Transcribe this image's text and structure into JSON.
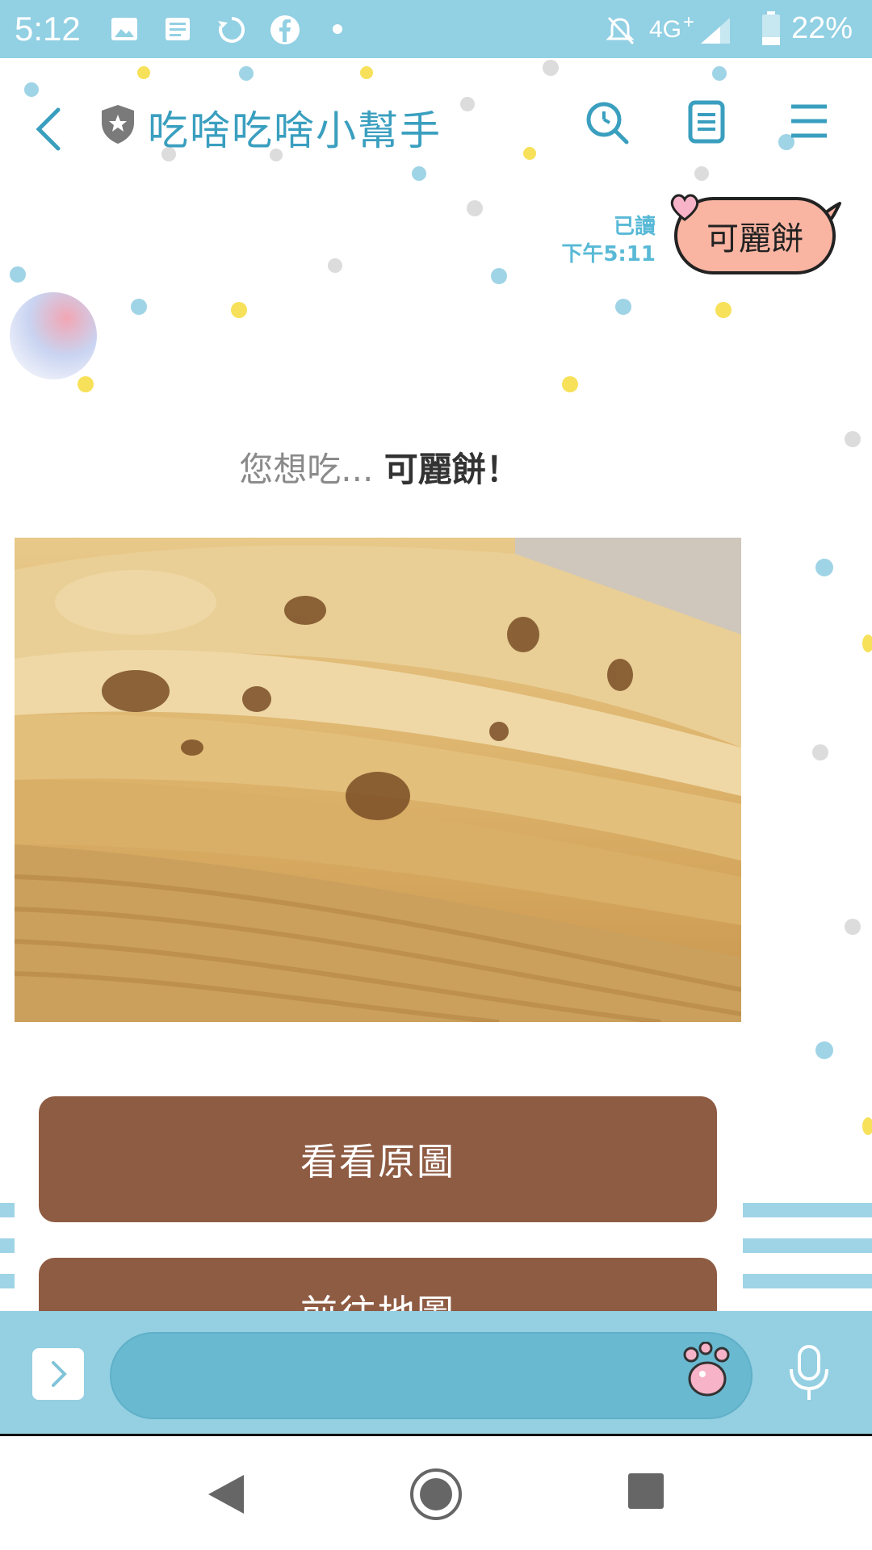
{
  "status_bar": {
    "time": "5:12",
    "network": "4G",
    "battery": "22%"
  },
  "header": {
    "title": "吃啥吃啥小幫手"
  },
  "messages": {
    "user": {
      "read_label": "已讀",
      "timestamp": "下午5:11",
      "text": "可麗餅"
    },
    "bot": {
      "prompt": "您想吃...",
      "answer": "可麗餅！"
    }
  },
  "actions": {
    "view_original": "看看原圖",
    "second_partial": "前往地圖"
  },
  "colors": {
    "header_blue": "#92d0e3",
    "title_blue": "#3a9fbf",
    "button_brown": "#8e5b43",
    "bubble_peach": "#f9b4a2"
  },
  "icons": [
    "back-icon",
    "shield-icon",
    "search-icon",
    "notes-icon",
    "menu-icon",
    "paw-icon",
    "microphone-icon",
    "expand-icon"
  ]
}
